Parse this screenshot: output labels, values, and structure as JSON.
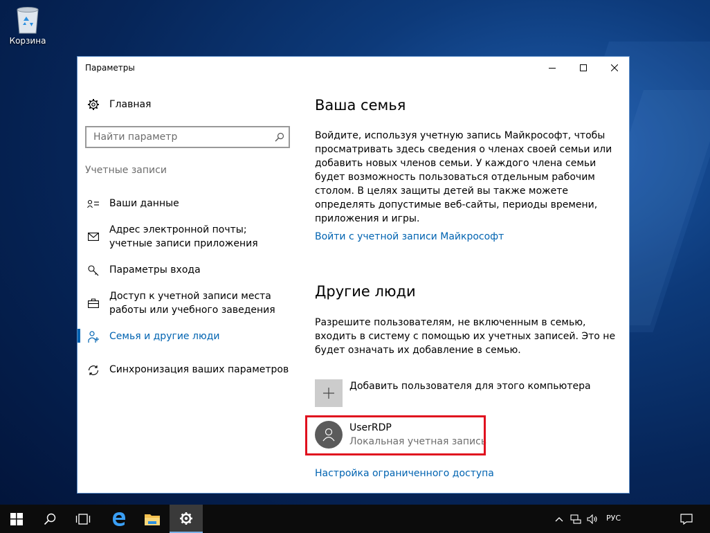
{
  "desktop": {
    "recycle_bin_label": "Корзина"
  },
  "window": {
    "title": "Параметры"
  },
  "nav": {
    "home_label": "Главная",
    "search_placeholder": "Найти параметр",
    "section_label": "Учетные записи",
    "items": [
      {
        "label": "Ваши данные",
        "icon": "person-card-icon"
      },
      {
        "label": "Адрес электронной почты; учетные записи приложения",
        "icon": "mail-icon"
      },
      {
        "label": "Параметры входа",
        "icon": "key-icon"
      },
      {
        "label": "Доступ к учетной записи места работы или учебного заведения",
        "icon": "briefcase-icon"
      },
      {
        "label": "Семья и другие люди",
        "icon": "people-icon",
        "active": true
      },
      {
        "label": "Синхронизация ваших параметров",
        "icon": "sync-icon"
      }
    ]
  },
  "content": {
    "family_heading": "Ваша семья",
    "family_text": "Войдите, используя учетную запись Майкрософт, чтобы просматривать здесь сведения о членах своей семьи или добавить новых членов семьи. У каждого члена семьи будет возможность пользоваться отдельным рабочим столом. В целях защиты детей вы также можете определять допустимые веб-сайты, периоды времени, приложения и игры.",
    "family_link": "Войти с учетной записи Майкрософт",
    "others_heading": "Другие люди",
    "others_text": "Разрешите пользователям, не включенным в семью, входить в систему с помощью их учетных записей. Это не будет означать их добавление в семью.",
    "add_user_label": "Добавить пользователя для этого компьютера",
    "user": {
      "name": "UserRDP",
      "account_type": "Локальная учетная запись"
    },
    "restricted_link": "Настройка ограниченного доступа"
  },
  "taskbar": {
    "language": "РУС"
  },
  "colors": {
    "accent": "#0063b1",
    "highlight": "#e0101e"
  }
}
